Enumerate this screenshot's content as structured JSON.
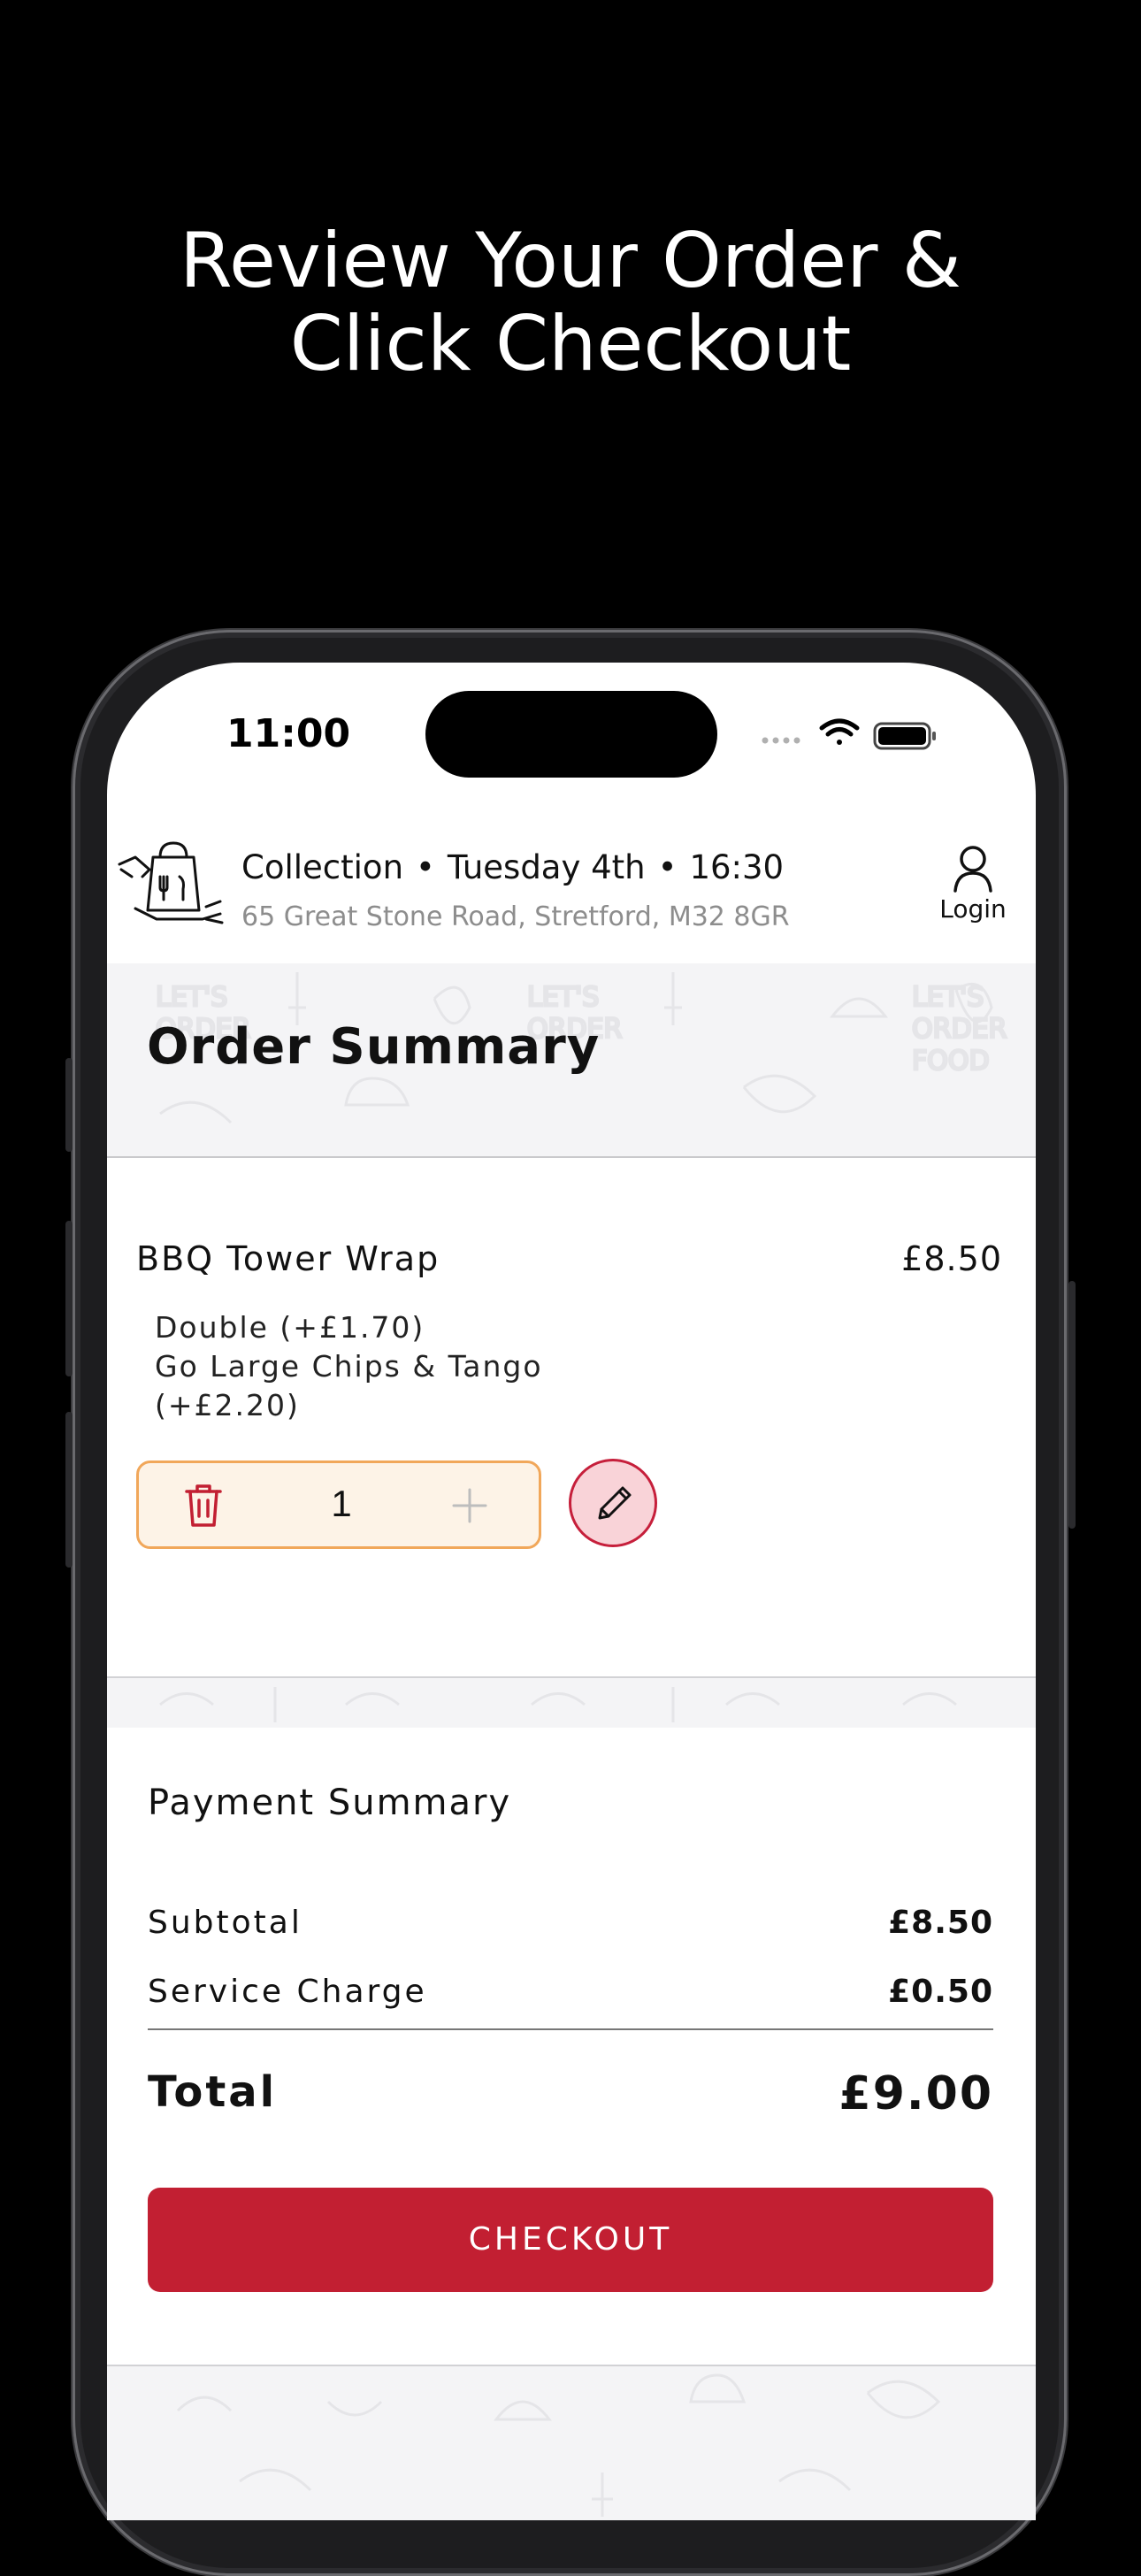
{
  "promo": {
    "headline_line1": "Review Your Order &",
    "headline_line2": "Click Checkout"
  },
  "status_bar": {
    "time": "11:00"
  },
  "header": {
    "order_type": "Collection",
    "day": "Tuesday 4th",
    "time": "16:30",
    "address": "65 Great Stone Road, Stretford, M32  8GR",
    "login_label": "Login"
  },
  "order_summary": {
    "title": "Order Summary",
    "items": [
      {
        "name": "BBQ Tower Wrap",
        "price": "£8.50",
        "modifiers": [
          "Double (+£1.70)",
          "Go Large Chips & Tango",
          "(+£2.20)"
        ],
        "quantity": "1"
      }
    ]
  },
  "payment_summary": {
    "title": "Payment Summary",
    "subtotal_label": "Subtotal",
    "subtotal_value": "£8.50",
    "service_label": "Service Charge",
    "service_value": "£0.50",
    "total_label": "Total",
    "total_value": "£9.00",
    "checkout_label": "CHECKOUT"
  },
  "colors": {
    "accent": "#c21f32",
    "qty_border": "#f1a75a",
    "qty_bg": "#fdf3e7"
  }
}
